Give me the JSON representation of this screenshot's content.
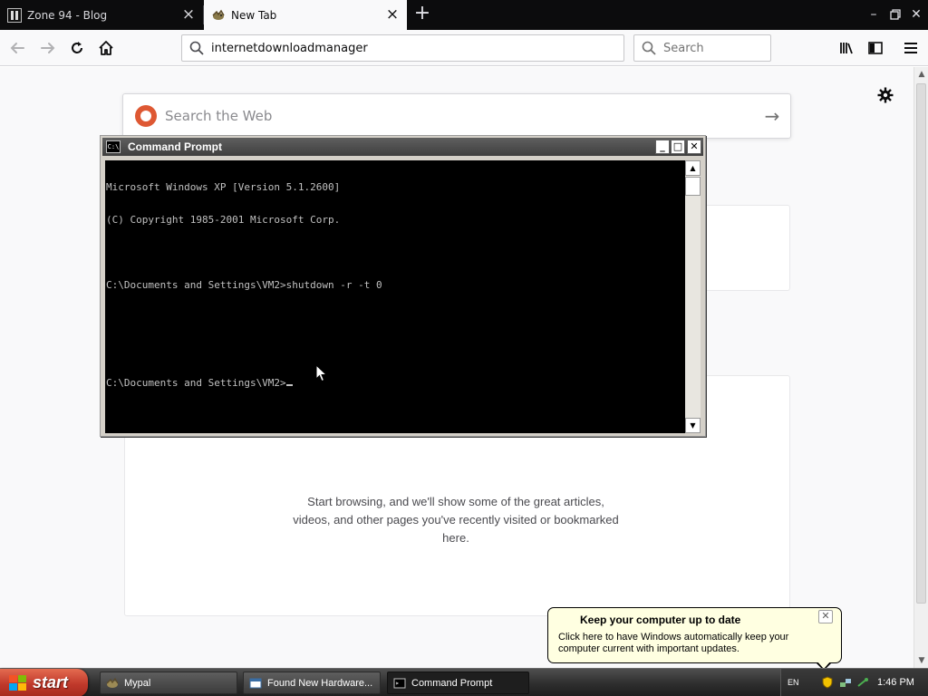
{
  "browser": {
    "tabs": [
      {
        "title": "Zone 94 - Blog",
        "active": false
      },
      {
        "title": "New Tab",
        "active": true
      }
    ],
    "url": "internetdownloadmanager",
    "search_placeholder": "Search"
  },
  "newtab": {
    "search_placeholder": "Search the Web",
    "empty_message": "Start browsing, and we'll show some of the great articles, videos, and other pages you've recently visited or bookmarked here."
  },
  "cmd": {
    "title": "Command Prompt",
    "icon_text": "C:\\",
    "lines": [
      "Microsoft Windows XP [Version 5.1.2600]",
      "(C) Copyright 1985-2001 Microsoft Corp.",
      "",
      "C:\\Documents and Settings\\VM2>shutdown -r -t 0",
      "",
      "",
      "C:\\Documents and Settings\\VM2>"
    ]
  },
  "balloon": {
    "title": "Keep your computer up to date",
    "text": "Click here to have Windows automatically keep your computer current with important updates."
  },
  "taskbar": {
    "start_label": "start",
    "tasks": [
      {
        "label": "Mypal",
        "icon": "mypal-icon",
        "active": false
      },
      {
        "label": "Found New Hardware...",
        "icon": "window-icon",
        "active": false
      },
      {
        "label": "Command Prompt",
        "icon": "cmd-icon",
        "active": true
      }
    ],
    "clock": "1:46 PM",
    "tray_language": "EN"
  },
  "colors": {
    "taskbar": "#2e2e2e",
    "start_button": "#c0392b",
    "balloon_bg": "#ffffe1",
    "console_bg": "#000000",
    "console_fg": "#c0c0c0"
  }
}
